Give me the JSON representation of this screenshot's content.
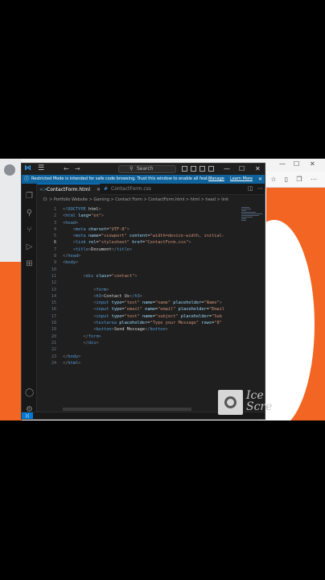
{
  "vscode": {
    "search_label": "Search",
    "banner": {
      "message": "Restricted Mode is intended for safe code browsing. Trust this window to enable all feat...",
      "manage": "Manage",
      "learn_more": "Learn More"
    },
    "tabs": [
      {
        "label": "ContactForm.html",
        "active": true
      },
      {
        "label": "ContactForm.css",
        "active": false
      }
    ],
    "breadcrumb": "D: > Portfolio Website > Gaming > Contact Form > ContactForm.html > html > head > link",
    "line_numbers": [
      "1",
      "2",
      "3",
      "4",
      "5",
      "6",
      "7",
      "8",
      "9",
      "10",
      "11",
      "12",
      "13",
      "14",
      "15",
      "16",
      "17",
      "18",
      "19",
      "20",
      "21",
      "22",
      "23",
      "24"
    ],
    "current_line": "6",
    "code_lines": [
      "<!DOCTYPE html>",
      "<html lang=\"en\">",
      "<head>",
      "    <meta charset=\"UTF-8\">",
      "    <meta name=\"viewport\" content=\"width=device-width, initial-",
      "    <link rel=\"stylesheet\" href=\"ContactForm.css\">",
      "    <title>Document</title>",
      "</head>",
      "<body>",
      "",
      "        <div class=\"contact\">",
      "",
      "            <form>",
      "            <h3>Contact Us</h3>",
      "            <input type=\"text\" name=\"name\" placeholder=\"Name\">",
      "            <input type=\"email\" name=\"email\" placeholder=\"Email",
      "            <input type=\"text\" name=\"subject\" placeholder=\"Sub",
      "            <textarea placeholder=\"Type your Message\" rows=\"8\"",
      "            <button>Send Message</button>",
      "        </form>",
      "        </div>",
      "",
      "</body>",
      "</html>"
    ]
  },
  "watermark": {
    "text_line1": "Ice",
    "text_line2": "Scre"
  },
  "colors": {
    "accent_blue": "#0078d4",
    "banner_blue": "#0e639c",
    "orange": "#f26522",
    "editor_bg": "#1f1f1f"
  }
}
